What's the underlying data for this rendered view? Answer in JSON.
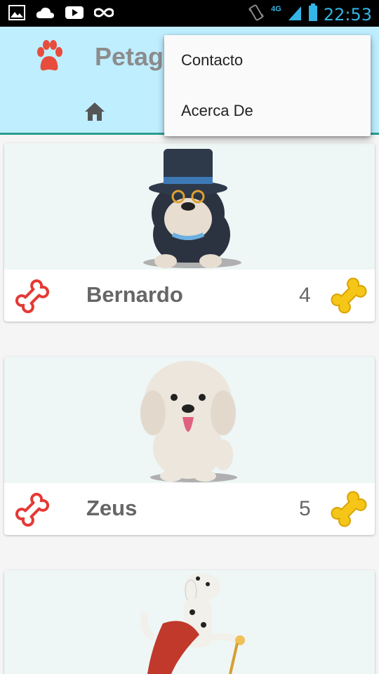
{
  "statusbar": {
    "time": "22:53",
    "network": "4G"
  },
  "appbar": {
    "title": "Petag"
  },
  "menu": {
    "items": [
      "Contacto",
      "Acerca De"
    ]
  },
  "pets": [
    {
      "name": "Bernardo",
      "likes": "4"
    },
    {
      "name": "Zeus",
      "likes": "5"
    },
    {
      "name": "",
      "likes": ""
    }
  ],
  "colors": {
    "appbar": "#bfeeff",
    "accent": "#2a9d8f",
    "bone_outline": "#e53935",
    "bone_gold": "#f5c518",
    "paw": "#e74c3c"
  }
}
